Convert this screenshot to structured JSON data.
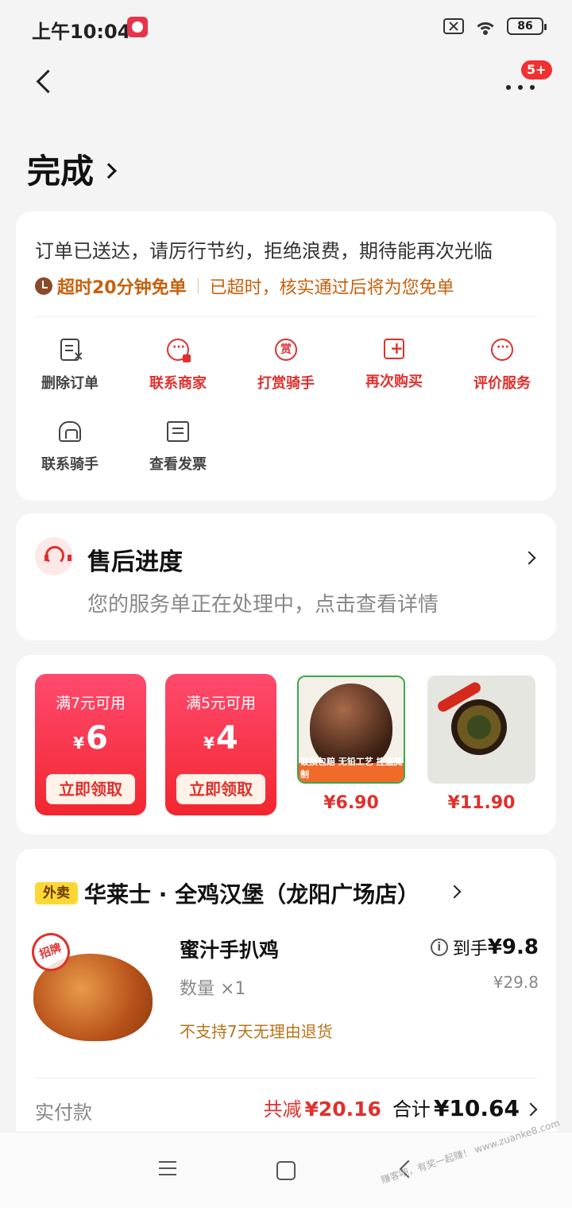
{
  "status_bar": {
    "time": "上午10:04",
    "battery": "86"
  },
  "header": {
    "more_badge": "5+",
    "status_title": "完成"
  },
  "order_card": {
    "message": "订单已送达，请厉行节约，拒绝浪费，期待能再次光临",
    "timeout_label": "超时20分钟免单",
    "timeout_note": "已超时，核实通过后将为您免单",
    "actions": [
      {
        "label": "删除订单",
        "icon": "delete-order-icon"
      },
      {
        "label": "联系商家",
        "icon": "contact-merchant-icon"
      },
      {
        "label": "打赏骑手",
        "icon": "tip-rider-icon"
      },
      {
        "label": "再次购买",
        "icon": "buy-again-icon"
      },
      {
        "label": "评价服务",
        "icon": "review-icon"
      },
      {
        "label": "联系骑手",
        "icon": "contact-rider-icon"
      },
      {
        "label": "查看发票",
        "icon": "invoice-icon"
      }
    ],
    "tip_glyph": "赏"
  },
  "after_sales": {
    "title": "售后进度",
    "description": "您的服务单正在处理中，点击查看详情"
  },
  "promos": {
    "coupons": [
      {
        "condition": "满7元可用",
        "currency": "¥",
        "amount": "6",
        "button": "立即领取"
      },
      {
        "condition": "满5元可用",
        "currency": "¥",
        "amount": "4",
        "button": "立即领取"
      }
    ],
    "products": [
      {
        "price": "¥6.90",
        "tag": "破损包赔 无铅工艺 控温腌制"
      },
      {
        "price": "¥11.90"
      }
    ]
  },
  "order_detail": {
    "tag": "外卖",
    "store_name": "华莱士 · 全鸡汉堡（龙阳广场店）",
    "item": {
      "badge": "招牌",
      "name": "蜜汁手扒鸡",
      "quantity": "数量 ×1",
      "note": "不支持7天无理由退货",
      "price_label": "到手",
      "final_price": "¥9.8",
      "original_price": "¥29.8"
    },
    "paid_label": "实付款",
    "discount_label": "共减",
    "discount_value": "¥20.16",
    "total_label": "合计",
    "total_value": "¥10.64"
  },
  "watermark": "赚客吧，有奖一起赚！ www.zuanke8.com"
}
